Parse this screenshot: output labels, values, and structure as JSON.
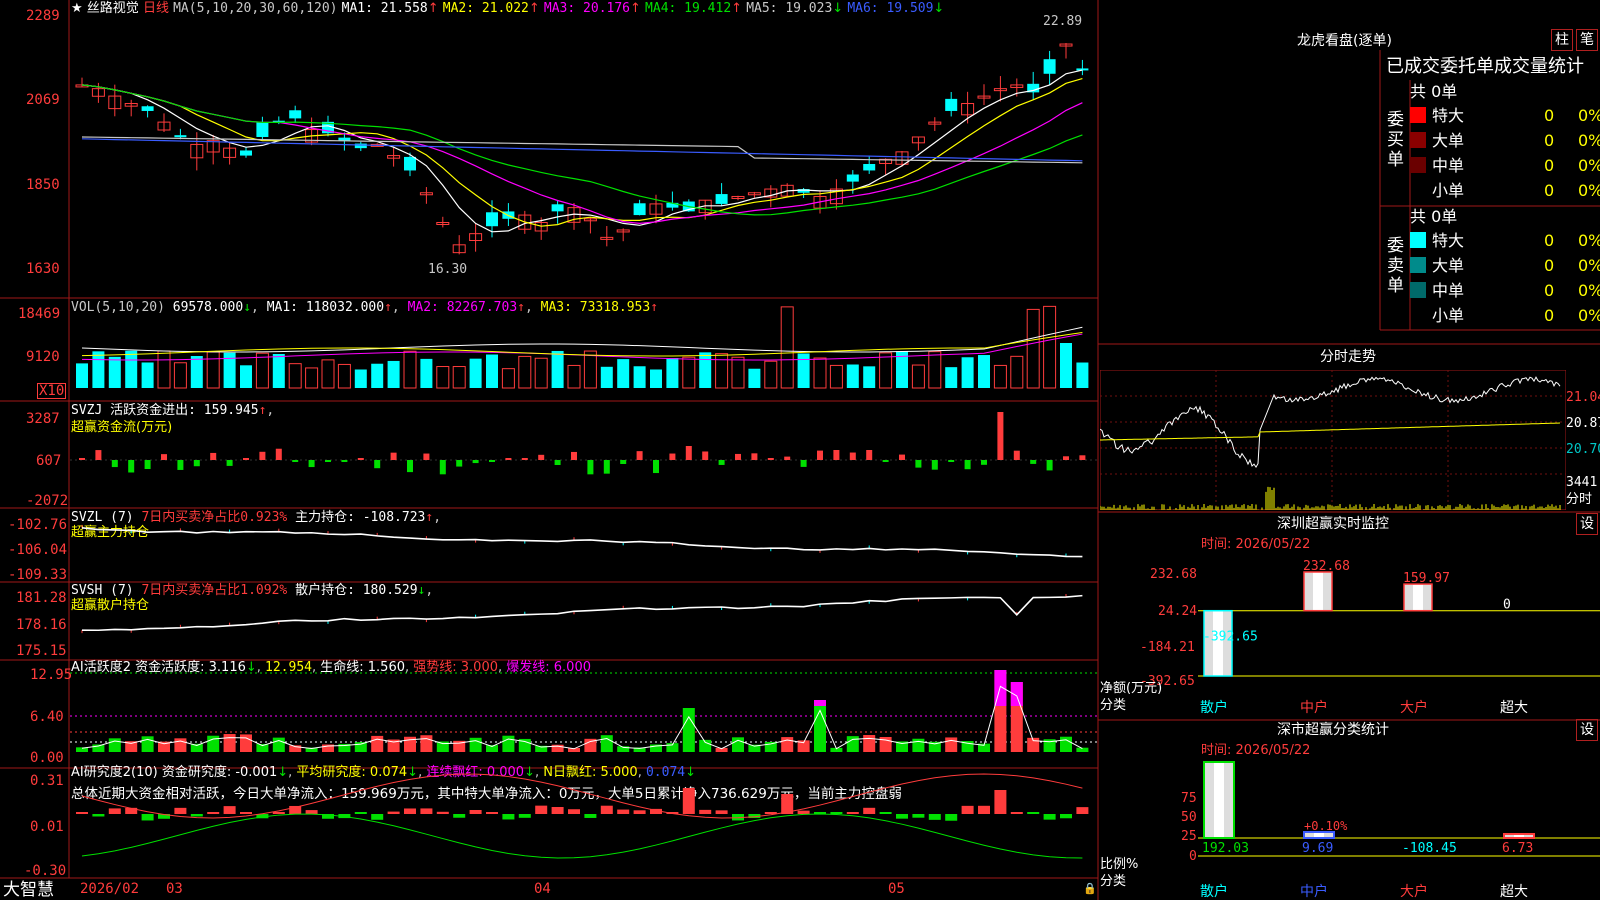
{
  "header": {
    "star": "★",
    "stock_name": "丝路视觉",
    "period": "日线",
    "ma_params": "MA(5,10,20,30,60,120)",
    "ma": [
      {
        "label": "MA1: 21.558",
        "arrow": "↑",
        "color": "#ffffff"
      },
      {
        "label": "MA2: 21.022",
        "arrow": "↑",
        "color": "#ffff00"
      },
      {
        "label": "MA3: 20.176",
        "arrow": "↑",
        "color": "#ff00ff"
      },
      {
        "label": "MA4: 19.412",
        "arrow": "↑",
        "color": "#00e000"
      },
      {
        "label": "MA5: 19.023",
        "arrow": "↓",
        "color": "#c8c8c8"
      },
      {
        "label": "MA6: 19.509",
        "arrow": "↓",
        "color": "#3a5cff"
      }
    ]
  },
  "price_axis": [
    "2289",
    "2069",
    "1850",
    "1630"
  ],
  "price_marks": {
    "high": "22.89",
    "low": "16.30"
  },
  "vol": {
    "params": "VOL(5,10,20)",
    "value": "69578.000",
    "value_arrow": "↓",
    "ma": [
      {
        "label": "MA1: 118032.000",
        "arrow": "↑",
        "color": "#ffffff"
      },
      {
        "label": "MA2: 82267.703",
        "arrow": "↑",
        "color": "#ff00ff"
      },
      {
        "label": "MA3: 73318.953",
        "arrow": "↑",
        "color": "#ffff00"
      }
    ],
    "axis": [
      "18469",
      "9120"
    ],
    "unit": "X10"
  },
  "svzj": {
    "title": "SVZJ  活跃资金进出: 159.945",
    "arrow": "↑",
    "sub": "超赢资金流(万元)",
    "axis": [
      "3287",
      "607",
      "-2072"
    ]
  },
  "svzl": {
    "title_a": "SVZL (7)",
    "title_b": "7日内买卖净占比0.923%",
    "title_c": "主力持仓: -108.723",
    "arrow": "↑",
    "sub": "超赢主力持仓",
    "axis": [
      "-102.76",
      "-106.04",
      "-109.33"
    ]
  },
  "svsh": {
    "title_a": "SVSH (7)",
    "title_b": "7日内买卖净占比1.092%",
    "title_c": "散户持仓: 180.529",
    "arrow": "↓",
    "sub": "超赢散户持仓",
    "axis": [
      "181.28",
      "178.16",
      "175.15"
    ]
  },
  "ai_active": {
    "title": "AI活跃度2 资金活跃度: 3.116",
    "a1": "↓",
    "v2": "12.954",
    "v3": "生命线: 1.560",
    "v4": "强势线: 3.000",
    "v5": "爆发线: 6.000",
    "axis": [
      "12.95",
      "6.40",
      "0.00"
    ]
  },
  "ai_research": {
    "title": "AI研究度2(10) 资金研究度: -0.001",
    "a1": "↓",
    "avg": "平均研究度: 0.074",
    "a2": "↓",
    "red1": "连续飘红: 0.000",
    "a3": "↓",
    "red2": "N日飘红: 5.000",
    "v6": "0.074",
    "a4": "↓",
    "summary": "总体近期大资金相对活跃，今日大单净流入：159.969万元，其中特大单净流入：0万元，大单5日累计净入736.629万元，当前主力控盘弱",
    "axis": [
      "0.31",
      "0.01",
      "-0.30"
    ]
  },
  "bottom": {
    "brand": "大智慧",
    "dates": [
      "2026/02",
      "03",
      "04",
      "05"
    ]
  },
  "dragon": {
    "title": "龙虎看盘(逐单)",
    "btn1": "柱",
    "btn2": "笔",
    "subtitle": "已成交委托单成交量统计",
    "buy_label": "委买单",
    "sell_label": "委卖单",
    "total": "共 0单",
    "rows": [
      {
        "name": "特大",
        "v": "0",
        "p": "0%"
      },
      {
        "name": "大单",
        "v": "0",
        "p": "0%"
      },
      {
        "name": "中单",
        "v": "0",
        "p": "0%"
      },
      {
        "name": "小单",
        "v": "0",
        "p": "0%"
      }
    ]
  },
  "intraday": {
    "title": "分时走势",
    "axis": [
      "21.04",
      "20.87",
      "20.70"
    ],
    "vol_label": "3441",
    "vol_unit": "分时"
  },
  "sz_monitor": {
    "title": "深圳超赢实时监控",
    "setting": "设",
    "time": "时间: 2026/05/22",
    "axis": [
      "232.68",
      "24.24",
      "-184.21",
      "-392.65"
    ],
    "ylabel": "净额(万元)",
    "xlabel": "分类",
    "bars": [
      {
        "cat": "散户",
        "value": -392.65,
        "label": "-392.65"
      },
      {
        "cat": "中户",
        "value": 232.68,
        "label": "232.68"
      },
      {
        "cat": "大户",
        "value": 159.97,
        "label": "159.97"
      },
      {
        "cat": "超大",
        "value": 0,
        "label": "0"
      }
    ]
  },
  "sz_class": {
    "title": "深市超赢分类统计",
    "setting": "设",
    "time": "时间: 2026/05/22",
    "axis": [
      "75",
      "50",
      "25",
      "0"
    ],
    "ylabel": "比例%",
    "xlabel": "分类",
    "bars": [
      {
        "cat": "散户",
        "value": 192.03,
        "label": "192.03",
        "top": ""
      },
      {
        "cat": "中户",
        "value": 9.69,
        "label": "9.69",
        "top": "+0.10%"
      },
      {
        "cat": "大户",
        "value": -108.45,
        "label": "-108.45",
        "top": ""
      },
      {
        "cat": "超大",
        "value": 6.73,
        "label": "6.73",
        "top": ""
      }
    ]
  }
}
